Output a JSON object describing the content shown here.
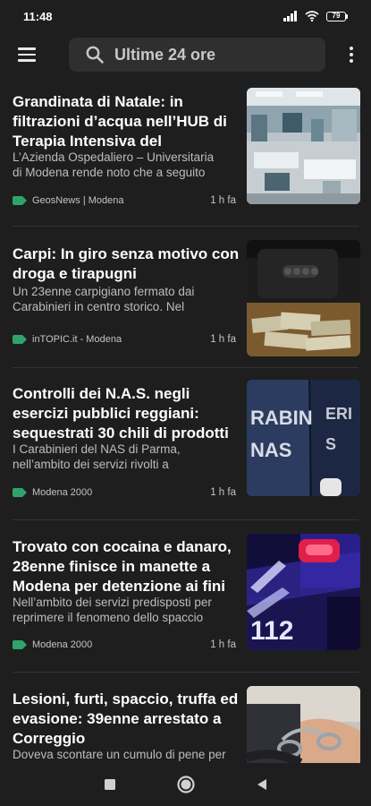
{
  "status_bar": {
    "time": "11:48",
    "battery": "79",
    "icons": [
      "signal-icon",
      "wifi-icon",
      "battery-icon"
    ]
  },
  "app_bar": {
    "menu_icon": "menu-icon",
    "search_icon": "search-icon",
    "search_text": "Ultime 24 ore",
    "more_icon": "more-vert-icon"
  },
  "colors": {
    "background": "#1e1e1e",
    "search_bg": "#2f2f2f",
    "source_tag": "#2fa36b",
    "divider": "#333333"
  },
  "articles": [
    {
      "headline": "Grandinata di Natale: in filtrazioni d’acqua nell’HUB di Terapia Intensiva del",
      "snippet_lines": [
        "L’Azienda Ospedaliero – Universitaria",
        "di Modena rende noto che a seguito"
      ],
      "source": "GeosNews | Modena",
      "time": "1 h fa",
      "image": "hospital-ward-photo"
    },
    {
      "headline": "Carpi: In giro senza motivo con droga e tirapugni",
      "snippet_lines": [
        "Un 23enne carpigiano fermato dai",
        "Carabinieri in centro storico. Nel"
      ],
      "source": "inTOPIC.it - Modena",
      "time": "1 h fa",
      "image": "seized-knuckles-and-cash-photo"
    },
    {
      "headline": "Controlli dei N.A.S. negli esercizi pubblici reggiani: sequestrati 30 chili di prodotti",
      "snippet_lines": [
        "I Carabinieri del NAS di Parma,",
        "nell’ambito dei servizi rivolti a"
      ],
      "source": "Modena 2000",
      "time": "1 h fa",
      "image": "carabinieri-nas-jacket-photo"
    },
    {
      "headline": "Trovato con cocaina e danaro, 28enne finisce in manette a Modena per detenzione ai fini",
      "snippet_lines": [
        "Nell’ambito dei servizi predisposti per",
        "reprimere il fenomeno dello spaccio"
      ],
      "source": "Modena 2000",
      "time": "1 h fa",
      "image": "police-car-112-photo"
    },
    {
      "headline": "Lesioni, furti, spaccio, truffa ed evasione: 39enne arrestato a Correggio",
      "snippet_lines": [
        "Doveva scontare un cumulo di pene per"
      ],
      "source": "",
      "time": "",
      "image": "handcuffs-photo"
    }
  ],
  "nav_bar": {
    "recents_icon": "recents-square-icon",
    "home_icon": "home-circle-icon",
    "back_icon": "back-triangle-icon"
  }
}
